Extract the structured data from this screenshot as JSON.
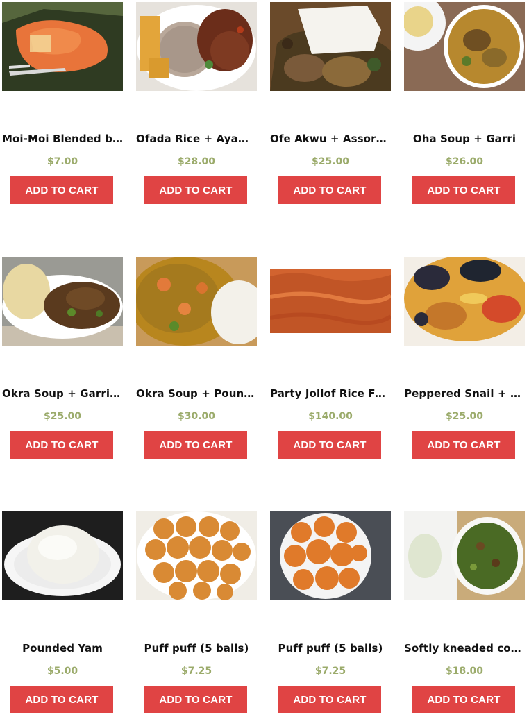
{
  "products": [
    {
      "name": "Moi-Moi Blended be...",
      "price": "$7.00",
      "cta": "ADD TO CART",
      "image": "moi-moi-image"
    },
    {
      "name": "Ofada Rice + Ayama...",
      "price": "$28.00",
      "cta": "ADD TO CART",
      "image": "ofada-rice-image"
    },
    {
      "name": "Ofe Akwu + Assorte...",
      "price": "$25.00",
      "cta": "ADD TO CART",
      "image": "ofe-akwu-image"
    },
    {
      "name": "Oha Soup + Garri",
      "price": "$26.00",
      "cta": "ADD TO CART",
      "image": "oha-soup-image"
    },
    {
      "name": "Okra Soup + Garri + ...",
      "price": "$25.00",
      "cta": "ADD TO CART",
      "image": "okra-garri-image"
    },
    {
      "name": "Okra Soup + Pound...",
      "price": "$30.00",
      "cta": "ADD TO CART",
      "image": "okra-pounded-image"
    },
    {
      "name": "Party Jollof Rice Full...",
      "price": "$140.00",
      "cta": "ADD TO CART",
      "image": "jollof-rice-image"
    },
    {
      "name": "Peppered Snail + Un...",
      "price": "$25.00",
      "cta": "ADD TO CART",
      "image": "peppered-snail-image"
    },
    {
      "name": "Pounded Yam",
      "price": "$5.00",
      "cta": "ADD TO CART",
      "image": "pounded-yam-image"
    },
    {
      "name": "Puff puff (5 balls)",
      "price": "$7.25",
      "cta": "ADD TO CART",
      "image": "puff-puff-image"
    },
    {
      "name": "Puff puff (5 balls)",
      "price": "$7.25",
      "cta": "ADD TO CART",
      "image": "puff-puff-bowl-image"
    },
    {
      "name": "Softly kneaded corn...",
      "price": "$18.00",
      "cta": "ADD TO CART",
      "image": "corn-fufu-image"
    }
  ],
  "colors": {
    "button": "#e04444",
    "button_text": "#ffffff",
    "price": "#9bab6b",
    "title": "#111111"
  }
}
